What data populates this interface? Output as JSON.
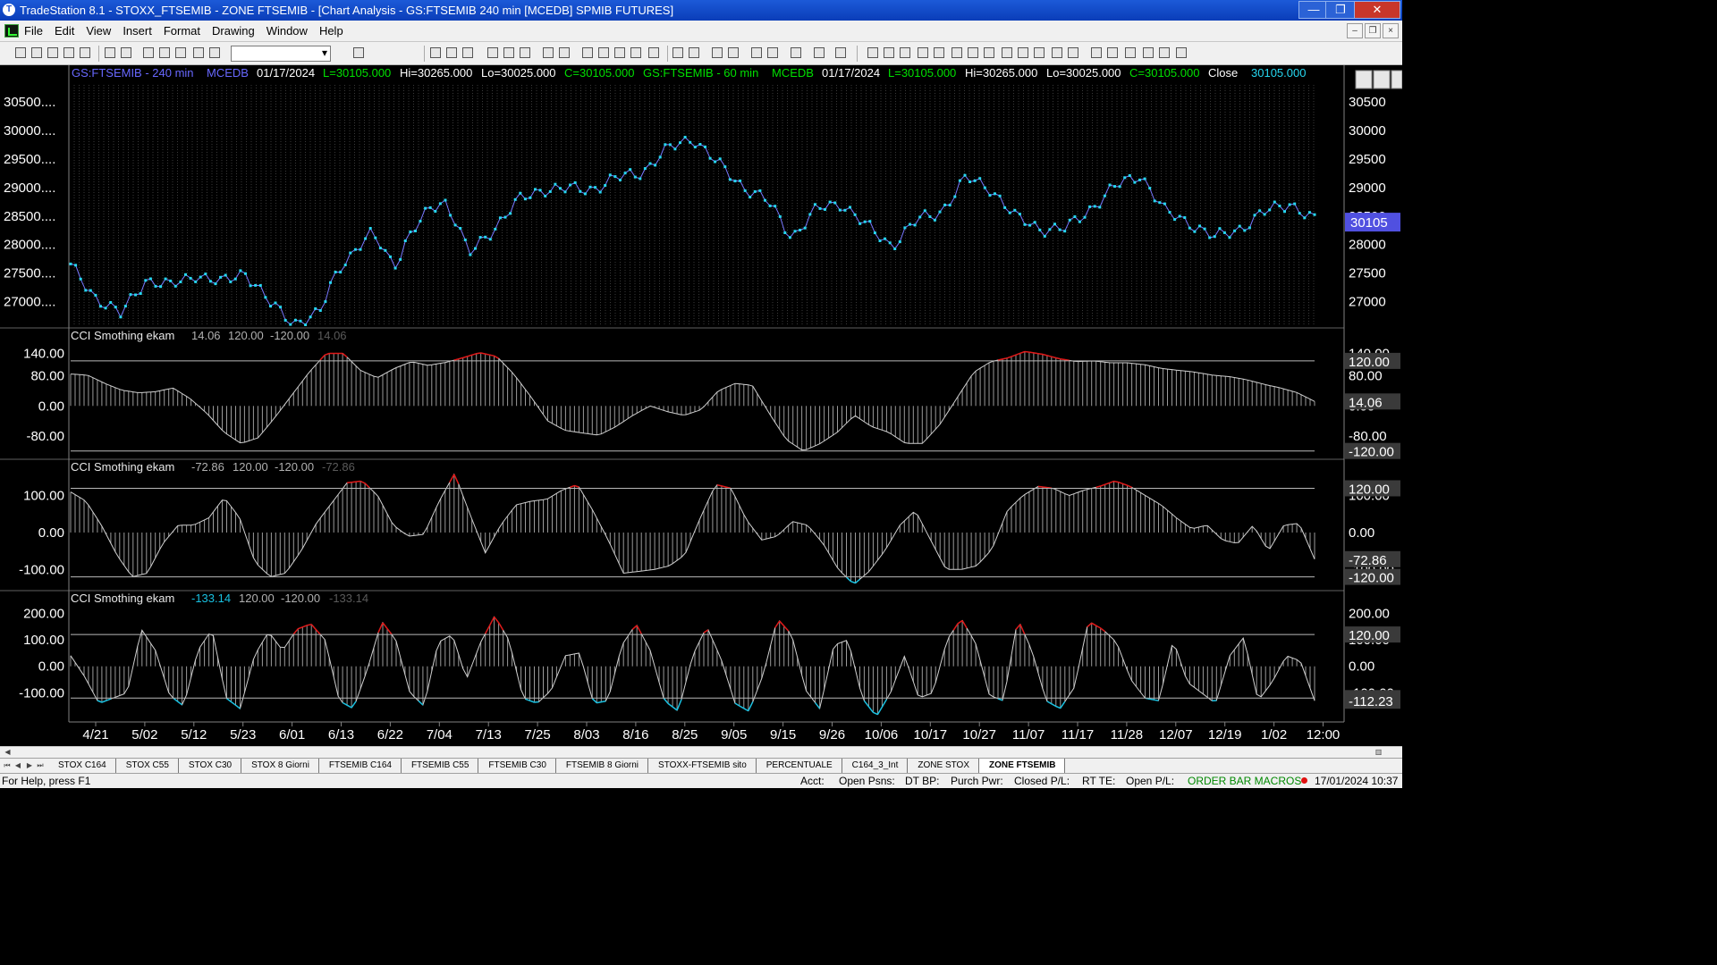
{
  "window": {
    "title": "TradeStation 8.1 - STOXX_FTSEMIB - ZONE FTSEMIB - [Chart Analysis - GS:FTSEMIB  240 min  [MCEDB] SPMIB FUTURES]",
    "minimize": "—",
    "maximize": "❐",
    "close": "✕"
  },
  "menu": {
    "items": [
      "File",
      "Edit",
      "View",
      "Insert",
      "Format",
      "Drawing",
      "Window",
      "Help"
    ],
    "mdi_min": "–",
    "mdi_restore": "❐",
    "mdi_close": "×"
  },
  "chart_header": {
    "sym1": "GS:FTSEMIB - 240 min",
    "src1": "MCEDB",
    "date1": "01/17/2024",
    "last1": "L=30105.000",
    "hi1": "Hi=30265.000",
    "lo1": "Lo=30025.000",
    "close1": "C=30105.000",
    "sym2": "GS:FTSEMIB - 60 min",
    "src2": "MCEDB",
    "date2": "01/17/2024",
    "last2": "L=30105.000",
    "hi2": "Hi=30265.000",
    "lo2": "Lo=30025.000",
    "close2": "C=30105.000",
    "close_label": "Close",
    "close_value": "30105.000"
  },
  "colors": {
    "price": "#26d7f0",
    "header_blue": "#6868ff",
    "header_green": "#00e000",
    "overbought": "#e01818",
    "oversold": "#18c0e0",
    "bars": "#9a9a9a",
    "level": "#b8b8b8",
    "axis_box": "#3a3a3a",
    "price_box": "#5050e0"
  },
  "chart_data": [
    {
      "type": "line",
      "title": "",
      "xlabel": "",
      "ylabel": "",
      "ylim": [
        26600,
        30800
      ],
      "y_ticks": [
        27000,
        27500,
        28000,
        28500,
        29000,
        29500,
        30000,
        30500
      ],
      "y_tick_labels_left": [
        "27000....",
        "27500....",
        "28000....",
        "28500....",
        "29000....",
        "29500....",
        "30000....",
        "30500...."
      ],
      "y_tick_labels_right": [
        "27000",
        "27500",
        "28000",
        "28500",
        "29000",
        "29500",
        "30000",
        "30500"
      ],
      "last_value_label": "30105",
      "x_ticks": [
        "4/21",
        "5/02",
        "5/12",
        "5/23",
        "6/01",
        "6/13",
        "6/22",
        "7/04",
        "7/13",
        "7/25",
        "8/03",
        "8/16",
        "8/25",
        "9/05",
        "9/15",
        "9/26",
        "10/06",
        "10/17",
        "10/27",
        "11/07",
        "11/17",
        "11/28",
        "12/07",
        "12/19",
        "1/02",
        "12:00"
      ],
      "series": [
        {
          "x": [
            0,
            2,
            4,
            6,
            8,
            10,
            12,
            14,
            16,
            18,
            20,
            21,
            22,
            23,
            24,
            25,
            26,
            27,
            28,
            29,
            30,
            31,
            32,
            34,
            36,
            38,
            40,
            42,
            44,
            46,
            48,
            50,
            52,
            54,
            56,
            58,
            60,
            62,
            64,
            66,
            68,
            70,
            72,
            74,
            76,
            78,
            80,
            82,
            84,
            86,
            88,
            90,
            92,
            94,
            96,
            98,
            100
          ],
          "values": [
            27600,
            27100,
            26750,
            27400,
            27250,
            27500,
            27300,
            27550,
            26950,
            26650,
            26750,
            27350,
            27750,
            27900,
            28150,
            28000,
            27650,
            28050,
            28350,
            28650,
            28800,
            28400,
            27800,
            28300,
            28750,
            29000,
            28950,
            29000,
            29150,
            29300,
            29650,
            29900,
            29400,
            29050,
            28750,
            28150,
            28600,
            28750,
            28300,
            28000,
            28400,
            28600,
            29150,
            29000,
            28450,
            28300,
            28250,
            28650,
            29000,
            29250,
            28550,
            28400,
            28100,
            28300,
            28550,
            28750,
            28400
          ]
        }
      ]
    },
    {
      "type": "bar",
      "title": "CCI Smothing ekam",
      "legend": [
        "14.06",
        "120.00",
        "-120.00",
        "14.06"
      ],
      "ylim": [
        -135,
        165
      ],
      "y_ticks": [
        140,
        80,
        0,
        -80
      ],
      "y_tick_labels": [
        "140.00",
        "80.00",
        "0.00",
        "-80.00"
      ],
      "levels": [
        120,
        -120
      ],
      "level_labels": [
        "120.00",
        "-120.00"
      ],
      "last_value_label": "14.06",
      "series": [
        {
          "name": "CCI",
          "values": [
            85,
            82,
            60,
            42,
            35,
            38,
            48,
            20,
            -20,
            -70,
            -100,
            -85,
            -30,
            30,
            90,
            140,
            140,
            95,
            75,
            100,
            118,
            108,
            116,
            128,
            142,
            132,
            85,
            25,
            -40,
            -65,
            -72,
            -78,
            -55,
            -25,
            0,
            -15,
            -25,
            -10,
            40,
            60,
            55,
            -20,
            -90,
            -120,
            -100,
            -70,
            -25,
            -55,
            -70,
            -100,
            -100,
            -50,
            20,
            90,
            118,
            128,
            145,
            138,
            126,
            118,
            120,
            115,
            115,
            110,
            100,
            95,
            90,
            82,
            78,
            70,
            58,
            48,
            35,
            12
          ]
        }
      ]
    },
    {
      "type": "bar",
      "title": "CCI Smothing ekam",
      "legend": [
        "-72.86",
        "120.00",
        "-120.00",
        "-72.86"
      ],
      "ylim": [
        -150,
        155
      ],
      "y_ticks": [
        100,
        0,
        -100
      ],
      "y_tick_labels": [
        "100.00",
        "0.00",
        "-100.00"
      ],
      "levels": [
        120,
        -120
      ],
      "level_labels": [
        "120.00",
        "-120.00"
      ],
      "last_value_label": "-72.86",
      "series": [
        {
          "name": "CCI",
          "values": [
            110,
            85,
            20,
            -60,
            -120,
            -110,
            -30,
            20,
            20,
            40,
            95,
            40,
            -80,
            -120,
            -110,
            -50,
            25,
            80,
            135,
            140,
            100,
            20,
            -10,
            -5,
            85,
            160,
            50,
            -55,
            20,
            75,
            85,
            90,
            115,
            130,
            60,
            -20,
            -110,
            -105,
            -100,
            -90,
            -60,
            40,
            130,
            120,
            35,
            -20,
            -10,
            30,
            20,
            -30,
            -100,
            -140,
            -105,
            -50,
            20,
            60,
            -20,
            -100,
            -100,
            -90,
            -45,
            60,
            100,
            125,
            120,
            100,
            115,
            125,
            140,
            125,
            100,
            75,
            40,
            10,
            20,
            -20,
            -30,
            20,
            -50,
            20,
            25,
            -72
          ]
        }
      ]
    },
    {
      "type": "bar",
      "title": "CCI Smothing ekam",
      "legend": [
        "-133.14",
        "120.00",
        "-120.00",
        "-133.14"
      ],
      "ylim": [
        -200,
        225
      ],
      "y_ticks": [
        200,
        100,
        0,
        -100
      ],
      "y_tick_labels": [
        "200.00",
        "100.00",
        "0.00",
        "-100.00"
      ],
      "levels": [
        120,
        -120
      ],
      "level_labels": [
        "120.00",
        "-112.23"
      ],
      "last_value_label": "-112.23",
      "series": [
        {
          "name": "CCI",
          "values": [
            40,
            -40,
            -140,
            -120,
            -100,
            140,
            60,
            -110,
            -150,
            60,
            140,
            -120,
            -160,
            40,
            130,
            60,
            140,
            160,
            100,
            -130,
            -160,
            -10,
            170,
            100,
            -100,
            -150,
            90,
            120,
            -50,
            90,
            190,
            100,
            -120,
            -140,
            -90,
            40,
            50,
            -140,
            -130,
            80,
            160,
            60,
            -130,
            -170,
            40,
            150,
            30,
            -140,
            -170,
            -30,
            180,
            120,
            -90,
            -160,
            80,
            100,
            -120,
            -190,
            -100,
            40,
            -120,
            -100,
            100,
            180,
            90,
            -110,
            -130,
            180,
            60,
            -130,
            -160,
            -80,
            170,
            140,
            90,
            -50,
            -120,
            -130,
            100,
            -60,
            -100,
            -140,
            40,
            110,
            -130,
            -60,
            40,
            20,
            -130
          ]
        }
      ]
    }
  ],
  "tabs": [
    "STOX C164",
    "STOX C55",
    "STOX  C30",
    "STOX  8 Giorni",
    "FTSEMIB C164",
    "FTSEMIB C55",
    "FTSEMIB C30",
    "FTSEMIB  8 Giorni",
    "STOXX-FTSEMIB sito",
    "PERCENTUALE",
    "C164_3_Int",
    "ZONE STOX",
    "ZONE FTSEMIB"
  ],
  "active_tab": "ZONE FTSEMIB",
  "status": {
    "help": "For Help, press F1",
    "acct": "Acct:",
    "open_psns": "Open Psns:",
    "dt_bp": "DT BP:",
    "purch_pwr": "Purch Pwr:",
    "closed_pl": "Closed P/L:",
    "rt_te": "RT TE:",
    "open_pl": "Open P/L:",
    "macros": "ORDER BAR  MACROS",
    "datetime": "17/01/2024 10:37"
  }
}
